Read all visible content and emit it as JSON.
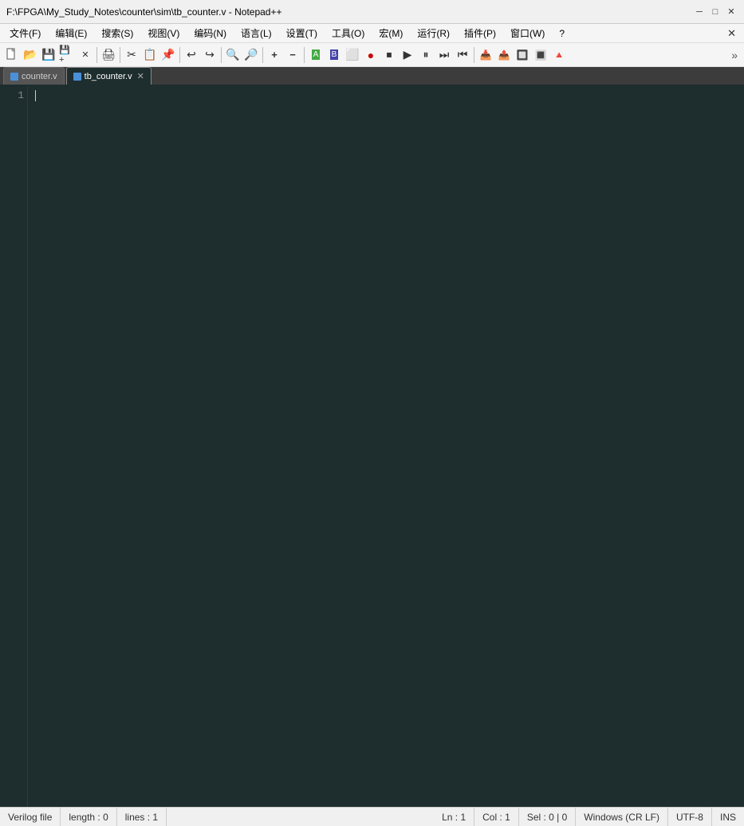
{
  "titleBar": {
    "title": "F:\\FPGA\\My_Study_Notes\\counter\\sim\\tb_counter.v - Notepad++",
    "minimizeLabel": "─",
    "maximizeLabel": "□",
    "closeLabel": "✕"
  },
  "menuBar": {
    "items": [
      {
        "label": "文件(F)"
      },
      {
        "label": "编辑(E)"
      },
      {
        "label": "搜索(S)"
      },
      {
        "label": "视图(V)"
      },
      {
        "label": "编码(N)"
      },
      {
        "label": "语言(L)"
      },
      {
        "label": "设置(T)"
      },
      {
        "label": "工具(O)"
      },
      {
        "label": "宏(M)"
      },
      {
        "label": "运行(R)"
      },
      {
        "label": "插件(P)"
      },
      {
        "label": "窗口(W)"
      },
      {
        "label": "?"
      }
    ],
    "closeX": "✕"
  },
  "toolbar": {
    "buttons": [
      {
        "icon": "📄",
        "name": "new"
      },
      {
        "icon": "📂",
        "name": "open"
      },
      {
        "icon": "💾",
        "name": "save"
      },
      {
        "icon": "💾",
        "name": "save-all"
      },
      {
        "icon": "🔒",
        "name": "close"
      },
      {
        "icon": "🖨",
        "name": "print"
      },
      {
        "icon": "✂",
        "name": "cut"
      },
      {
        "icon": "📋",
        "name": "copy"
      },
      {
        "icon": "📌",
        "name": "paste"
      },
      {
        "icon": "↩",
        "name": "undo"
      },
      {
        "icon": "↪",
        "name": "redo"
      },
      {
        "icon": "🔍",
        "name": "find"
      },
      {
        "icon": "🔎",
        "name": "find-next"
      },
      {
        "icon": "📦",
        "name": "replace"
      },
      {
        "icon": "📝",
        "name": "indent"
      },
      {
        "icon": "📝",
        "name": "outdent"
      },
      {
        "icon": "📑",
        "name": "bookmark"
      },
      {
        "icon": "⏸",
        "name": "pause"
      },
      {
        "icon": "▶",
        "name": "run"
      },
      {
        "icon": "⏭",
        "name": "next"
      },
      {
        "icon": "⏮",
        "name": "prev"
      }
    ],
    "expandIcon": "»"
  },
  "tabs": [
    {
      "label": "counter.v",
      "active": false,
      "hasClose": false
    },
    {
      "label": "tb_counter.v",
      "active": true,
      "hasClose": true
    }
  ],
  "editor": {
    "lineNumbers": [
      "1"
    ],
    "content": ""
  },
  "statusBar": {
    "fileType": "Verilog file",
    "length": "length : 0",
    "lines": "lines : 1",
    "ln": "Ln : 1",
    "col": "Col : 1",
    "sel": "Sel : 0 | 0",
    "lineEnding": "Windows (CR LF)",
    "encoding": "UTF-8",
    "mode": "INS"
  }
}
